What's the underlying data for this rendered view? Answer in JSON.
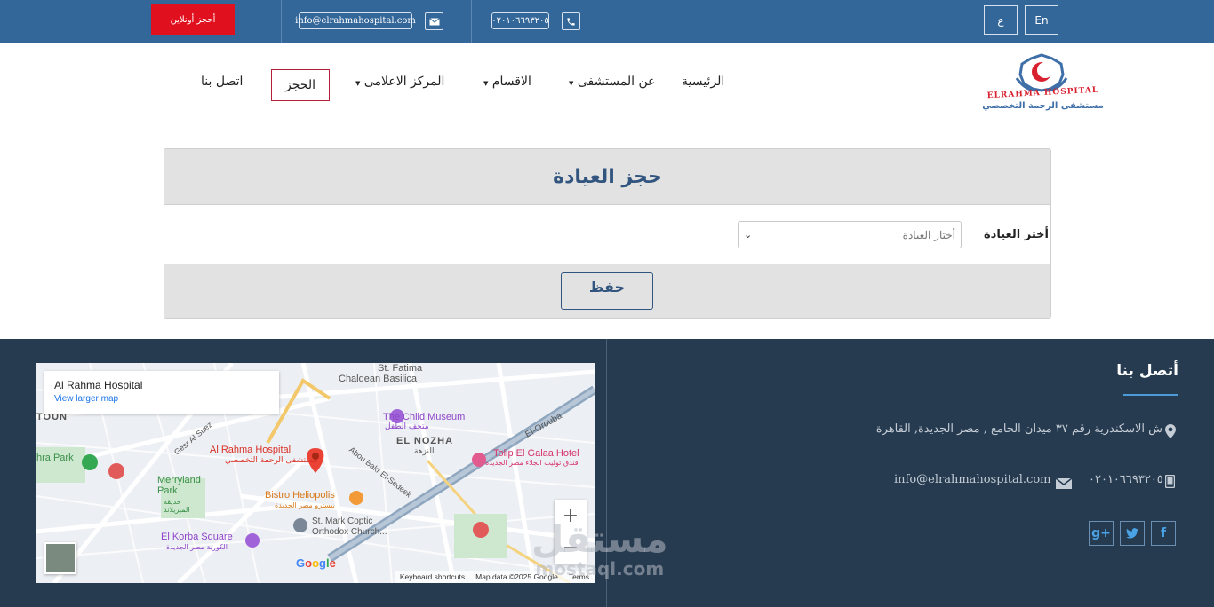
{
  "topbar": {
    "book_online": "أحجز أونلاين",
    "email": "info@elrahmahospital.com",
    "phone": "٠٢٠١٠٦٦٩٣٢٠٥",
    "lang_ar": "ع",
    "lang_en": "En"
  },
  "nav": {
    "home": "الرئيسية",
    "about": "عن المستشفى",
    "departments": "الاقسام",
    "media": "المركز الاعلامى",
    "booking": "الحجز",
    "contact": "اتصل بنا"
  },
  "logo": {
    "text_en": "ELRAHMA HOSPITAL",
    "text_ar": "مستشفى الرحمة التخصصي"
  },
  "form": {
    "title": "حجز العيادة",
    "clinic_label": "أختر العيادة",
    "clinic_placeholder": "أختار العيادة",
    "save_label": "حفظ"
  },
  "map": {
    "place_name": "Al Rahma Hospital",
    "larger_map": "View larger map",
    "labels": {
      "st_fatima": "St. Fatima",
      "chaldean": "Chaldean Basilica",
      "child_museum": "The Child Museum",
      "child_museum_ar": "متحف الطفل",
      "el_nozha": "EL NOZHA",
      "el_nozha_ar": "النزهة",
      "el_orouba": "El-Orouba",
      "tolip": "Tolip El Galaa Hotel",
      "tolip_ar": "فندق توليب الجلاء مصر الجديدة",
      "rahma": "Al Rahma Hospital",
      "rahma_ar": "مستشفى الرحمة التخصصي",
      "merryland": "Merryland Park",
      "merryland_ar": "حديقة الميريلاند",
      "bistro": "Bistro Heliopolis",
      "bistro_ar": "بيسترو مصر الجديدة",
      "st_mark": "St. Mark Coptic Orthodox Church...",
      "korba": "El Korba Square",
      "korba_ar": "الكوربة مصر الجديدة",
      "abou_bakr": "Abou Bakr El-Sedeek",
      "gesr": "Gesr Al Suez",
      "hra_park": "hra Park",
      "toun": "TOUN"
    },
    "attribution": {
      "shortcuts": "Keyboard shortcuts",
      "data": "Map data ©2025 Google",
      "terms": "Terms"
    },
    "google": "Google"
  },
  "footer": {
    "contact_title": "أتصل بنا",
    "address": "ش الاسكندرية رقم ٣٧ ميدان الجامع , مصر الجديدة, القاهرة",
    "email": "info@elrahmahospital.com",
    "phone": "٠٢٠١٠٦٦٩٣٢٠٥",
    "watermark": "مستقل",
    "watermark_url": "mostaql.com"
  },
  "colors": {
    "topbar": "#336699",
    "footer": "#263b50",
    "accent_red": "#e0101e",
    "brand_blue": "#32557f"
  }
}
